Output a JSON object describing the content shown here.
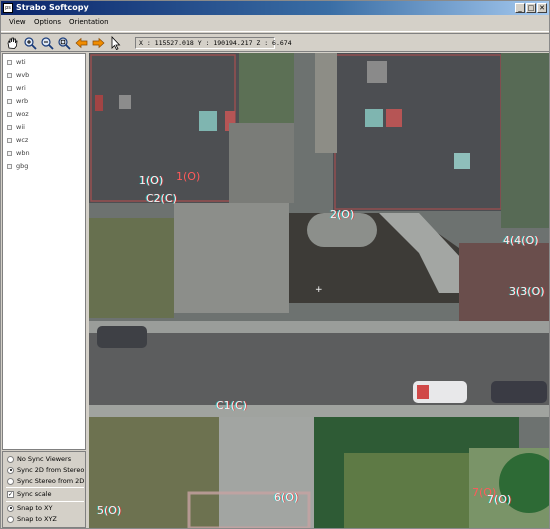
{
  "window": {
    "title": "Strabo Softcopy",
    "app_icon_text": "ps",
    "minimize": "_",
    "maximize": "□",
    "close": "✕"
  },
  "menu": [
    "View",
    "Options",
    "Orientation"
  ],
  "toolbar": {
    "tools": [
      "pan-hand-icon",
      "zoom-in-icon",
      "zoom-out-icon",
      "zoom-fit-icon",
      "arrow-left-icon",
      "arrow-right-icon",
      "pointer-icon"
    ],
    "coordinates": "X : 115527.018   Y : 190194.217   Z : 6.674"
  },
  "layers": [
    "wti",
    "wvb",
    "wri",
    "wrb",
    "woz",
    "wii",
    "wcz",
    "wbn",
    "gbg"
  ],
  "options": {
    "sync_viewers": [
      {
        "label": "No Sync Viewers",
        "selected": false
      },
      {
        "label": "Sync 2D from Stereo",
        "selected": true
      },
      {
        "label": "Sync Stereo from 2D",
        "selected": false
      }
    ],
    "sync_scale": {
      "label": "Sync scale",
      "checked": true
    },
    "snap": [
      {
        "label": "Snap to XY",
        "selected": true
      },
      {
        "label": "Snap to XYZ",
        "selected": false
      }
    ]
  },
  "points": [
    {
      "label": "1(O)",
      "color": "white"
    },
    {
      "label": "1(O)",
      "color": "red"
    },
    {
      "label": "C2(C)",
      "color": "white"
    },
    {
      "label": "2(O)",
      "color": "white"
    },
    {
      "label": "4(4(O)",
      "color": "white"
    },
    {
      "label": "3(3(O)",
      "color": "white"
    },
    {
      "label": "C1(C)",
      "color": "white"
    },
    {
      "label": "5(O)",
      "color": "white"
    },
    {
      "label": "6(O)",
      "color": "white"
    },
    {
      "label": "7(O)",
      "color": "red"
    },
    {
      "label": "7(O)",
      "color": "white"
    }
  ],
  "colors": {
    "titlebar_start": "#0a246a",
    "titlebar_end": "#a6caf0",
    "chrome": "#d4d0c8",
    "anaglyph_red": "#ff5a5a",
    "anaglyph_cyan": "#3cd2d2"
  }
}
